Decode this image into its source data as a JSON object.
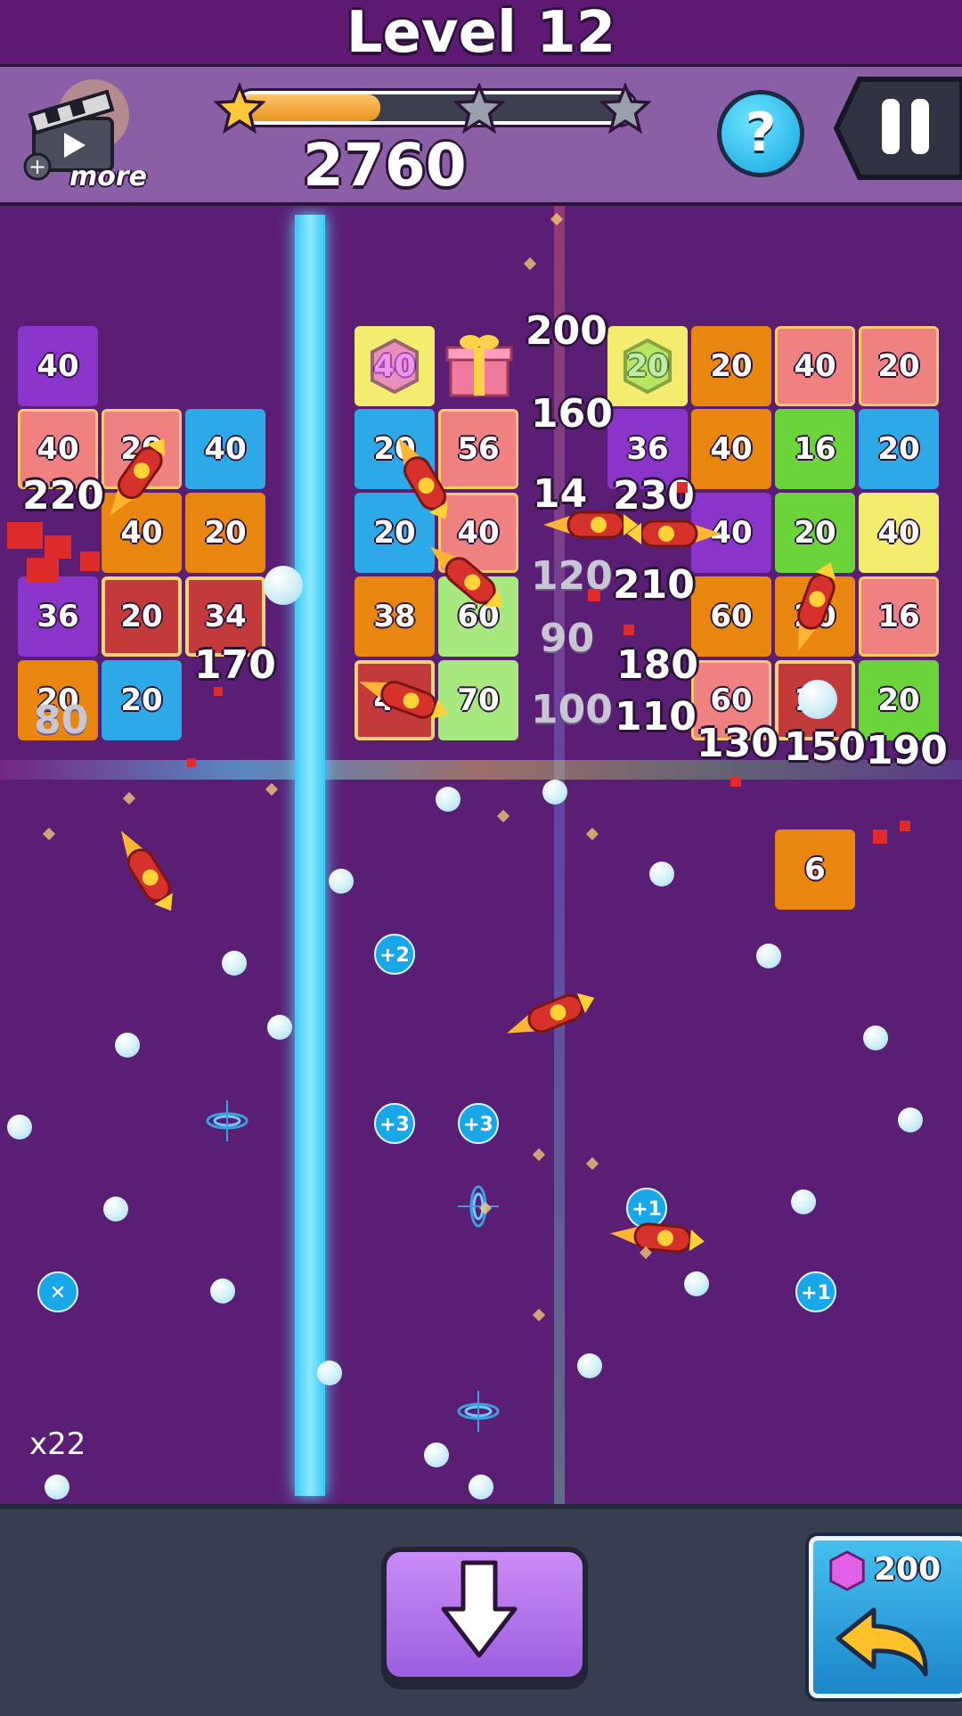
{
  "header": {
    "title": "Level 12"
  },
  "hud": {
    "more_label": "more",
    "score": "2760",
    "progress": 0.36,
    "stars": [
      "star-1",
      "star-2",
      "star-3"
    ],
    "help_symbol": "?"
  },
  "blocks": [
    {
      "label": "40",
      "style": "b-purple"
    },
    {
      "label": "40",
      "style": "b-salmon"
    },
    {
      "label": "20",
      "style": "b-salmon"
    },
    {
      "label": "40",
      "style": "b-blue"
    },
    {
      "label": "40",
      "style": "b-orange"
    },
    {
      "label": "20",
      "style": "b-orange"
    },
    {
      "label": "36",
      "style": "b-purple"
    },
    {
      "label": "20",
      "style": "b-red"
    },
    {
      "label": "34",
      "style": "b-red"
    },
    {
      "label": "20",
      "style": "b-orange"
    },
    {
      "label": "20",
      "style": "b-blue"
    },
    {
      "label": "40",
      "style": "b-yellow"
    },
    {
      "label": "20",
      "style": "b-blue"
    },
    {
      "label": "56",
      "style": "b-salmon"
    },
    {
      "label": "20",
      "style": "b-blue"
    },
    {
      "label": "40",
      "style": "b-salmon"
    },
    {
      "label": "38",
      "style": "b-orange"
    },
    {
      "label": "60",
      "style": "b-green-light"
    },
    {
      "label": "40",
      "style": "b-red"
    },
    {
      "label": "70",
      "style": "b-green-light"
    },
    {
      "label": "20",
      "style": "b-yellow"
    },
    {
      "label": "20",
      "style": "b-orange"
    },
    {
      "label": "40",
      "style": "b-salmon"
    },
    {
      "label": "20",
      "style": "b-salmon"
    },
    {
      "label": "36",
      "style": "b-purple"
    },
    {
      "label": "40",
      "style": "b-orange"
    },
    {
      "label": "16",
      "style": "b-green"
    },
    {
      "label": "20",
      "style": "b-blue"
    },
    {
      "label": "40",
      "style": "b-purple"
    },
    {
      "label": "20",
      "style": "b-green"
    },
    {
      "label": "40",
      "style": "b-yellow"
    },
    {
      "label": "60",
      "style": "b-orange"
    },
    {
      "label": "20",
      "style": "b-orange"
    },
    {
      "label": "16",
      "style": "b-salmon"
    },
    {
      "label": "60",
      "style": "b-salmon"
    },
    {
      "label": "10",
      "style": "b-red"
    },
    {
      "label": "20",
      "style": "b-green"
    },
    {
      "label": "6",
      "style": "b-orange"
    }
  ],
  "hit_numbers": [
    "200",
    "160",
    "220",
    "230",
    "210",
    "170",
    "90",
    "180",
    "100",
    "110",
    "130",
    "150",
    "190",
    "80",
    "120",
    "14"
  ],
  "bonuses": [
    "+2",
    "+3",
    "+3",
    "+1",
    "+1"
  ],
  "ball_count": "x22",
  "undo": {
    "price": "200"
  },
  "colors": {
    "accent": "#3ac8f5",
    "background": "#5a1f74",
    "hud": "#8a5fa5"
  }
}
